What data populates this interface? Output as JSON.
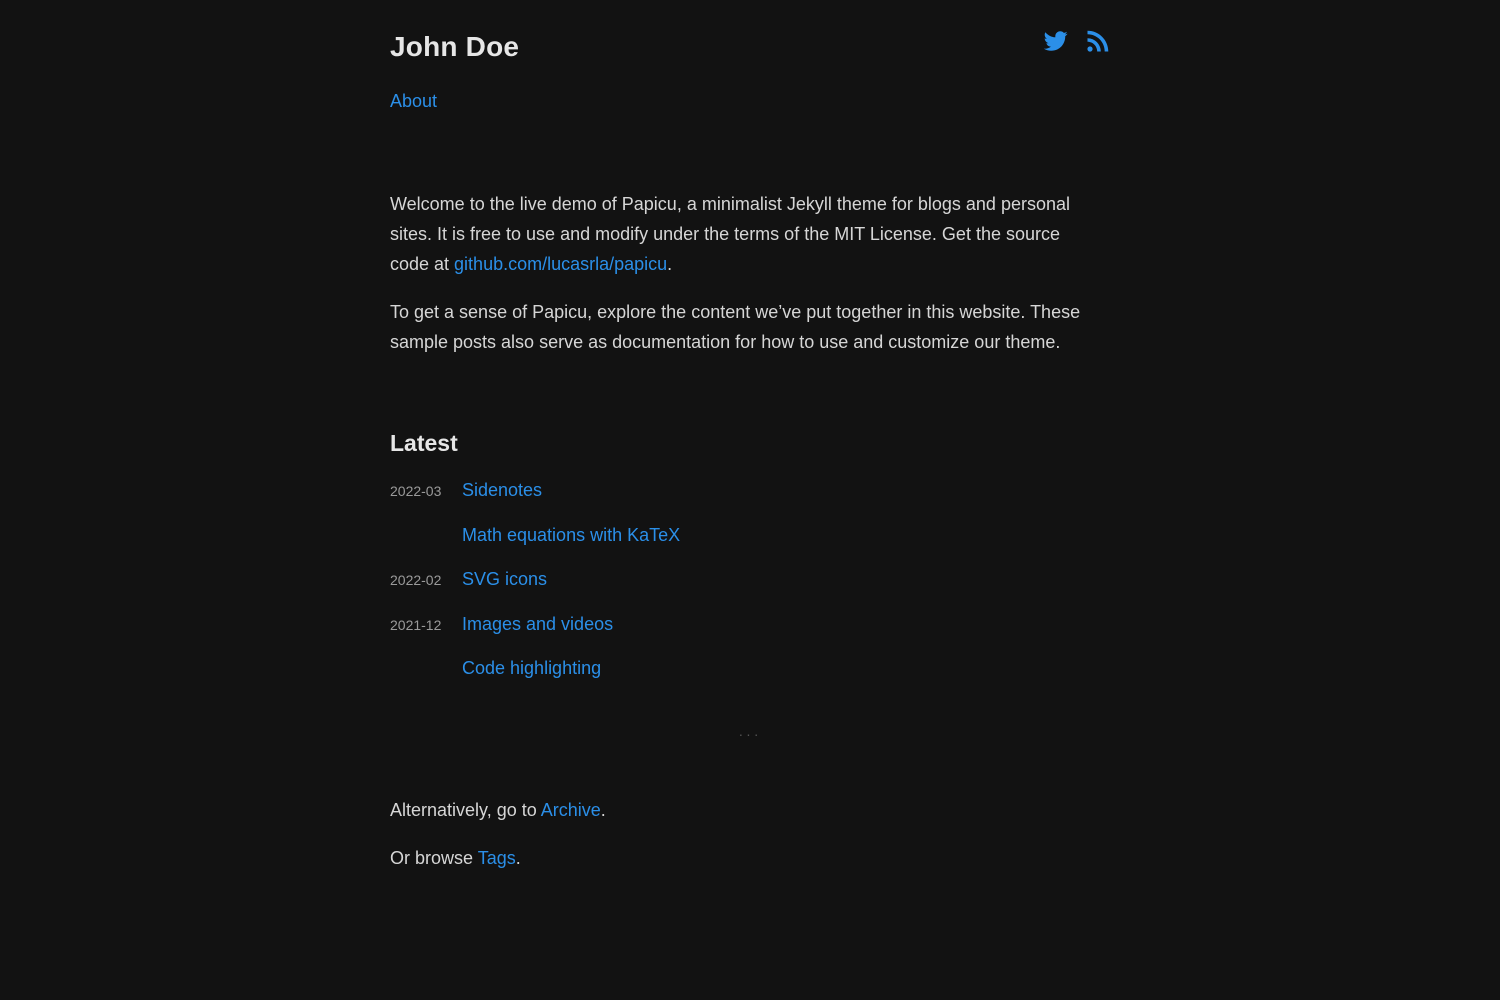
{
  "header": {
    "site_title": "John Doe",
    "nav": {
      "about": "About"
    },
    "social": [
      {
        "name": "twitter-icon",
        "color": "#2b8fe8"
      },
      {
        "name": "rss-icon",
        "color": "#2b8fe8"
      }
    ]
  },
  "intro": {
    "p1_text": "Welcome to the live demo of Papicu, a minimalist Jekyll theme for blogs and personal sites. It is free to use and modify under the terms of the MIT License. Get the source code at ",
    "p1_link": "github.com/lucasrla/papicu",
    "p1_end": ".",
    "p2_text": "To get a sense of Papicu, explore the content we’ve put together in this website. These sample posts also serve as documentation for how to use and customize our theme."
  },
  "latest": {
    "heading": "Latest",
    "posts": [
      {
        "date": "2022-03",
        "title": "Sidenotes"
      },
      {
        "date": "",
        "title": "Math equations with KaTeX"
      },
      {
        "date": "2022-02",
        "title": "SVG icons"
      },
      {
        "date": "2021-12",
        "title": "Images and videos"
      },
      {
        "date": "",
        "title": "Code highlighting"
      }
    ],
    "more": "···"
  },
  "footer": {
    "archive_prefix": "Alternatively, go to ",
    "archive_link": "Archive",
    "archive_suffix": ".",
    "tags_prefix": "Or browse ",
    "tags_link": "Tags",
    "tags_suffix": "."
  },
  "colors": {
    "background": "#121212",
    "text": "#d6d6d6",
    "accent": "#2b8fe8",
    "muted": "#9a9a9a"
  }
}
